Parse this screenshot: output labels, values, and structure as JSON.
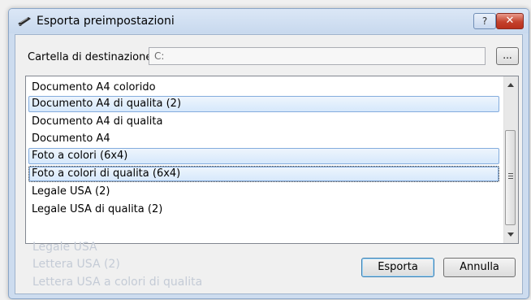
{
  "window": {
    "title": "Esporta preimpostazioni",
    "help_label": "?",
    "close_label": "✕"
  },
  "destination": {
    "label": "Cartella di destinazione",
    "value": "C:",
    "browse_label": "..."
  },
  "list": {
    "items": [
      {
        "label": "Documento A4 colorido",
        "selected": false
      },
      {
        "label": "Documento A4 di qualita (2)",
        "selected": true
      },
      {
        "label": "Documento A4 di qualita",
        "selected": false
      },
      {
        "label": "Documento A4",
        "selected": false
      },
      {
        "label": "Foto a colori (6x4)",
        "selected": true
      },
      {
        "label": "Foto a colori di qualita (6x4)",
        "selected": true,
        "focused": true
      },
      {
        "label": "Legale USA (2)",
        "selected": false
      },
      {
        "label": "Legale USA di qualita (2)",
        "selected": false
      }
    ],
    "ghost_items": [
      "Legale USA",
      "Lettera USA (2)",
      "Lettera USA a colori di qualita"
    ]
  },
  "buttons": {
    "export_label": "Esporta",
    "cancel_label": "Annulla"
  },
  "colors": {
    "selection": "#d6e8fb",
    "selection_border": "#84acdd",
    "close": "#c4412c"
  }
}
